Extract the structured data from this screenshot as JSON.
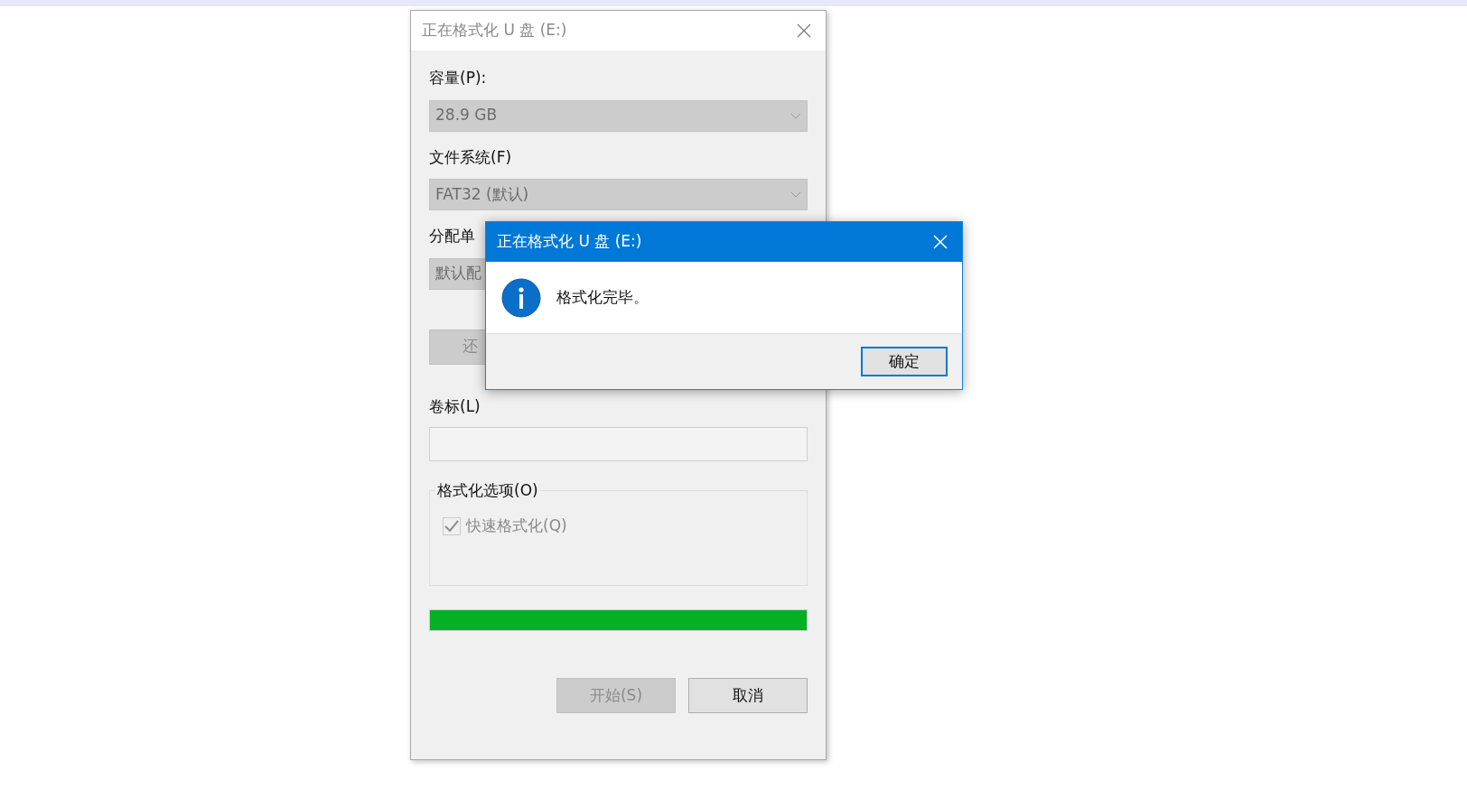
{
  "format_window": {
    "title": "正在格式化 U 盘 (E:)",
    "active": false,
    "fields": [
      {
        "label": "容量(P):",
        "value": "28.9 GB"
      },
      {
        "label": "文件系统(F)",
        "value": "FAT32 (默认)"
      },
      {
        "label": "分配单",
        "value": "默认配"
      }
    ],
    "restore_button": {
      "label": "还",
      "disabled": true
    },
    "volume_label": {
      "label": "卷标(L)"
    },
    "options": {
      "legend": "格式化选项(O)",
      "items": [
        {
          "label": "快速格式化(Q)",
          "checked": true,
          "disabled": true
        }
      ]
    },
    "progress": {
      "level": 1
    },
    "buttons": [
      {
        "label": "开始(S)",
        "disabled": true
      },
      {
        "label": "取消",
        "disabled": false
      }
    ]
  },
  "message_box": {
    "title": "正在格式化 U 盘 (E:)",
    "active": true,
    "message": "格式化完毕。",
    "buttons": [
      {
        "label": "确定",
        "default": true
      }
    ]
  }
}
